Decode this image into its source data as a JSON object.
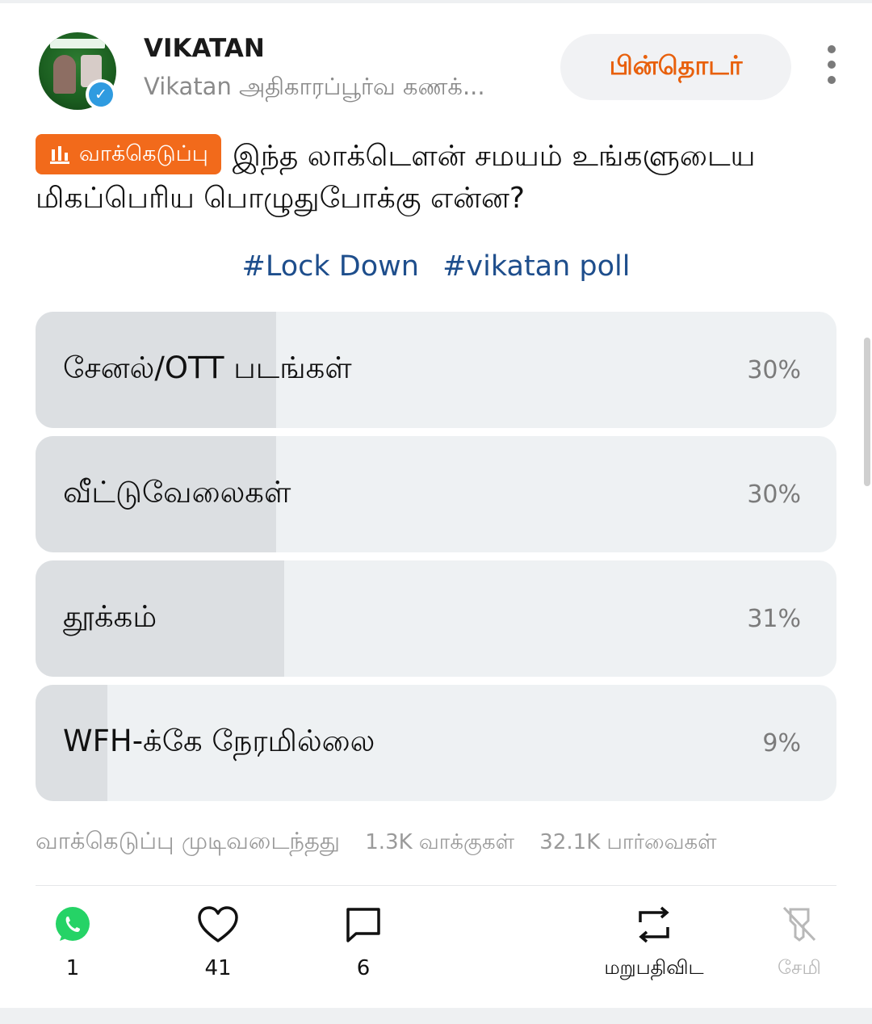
{
  "post": {
    "author_name": "VIKATAN",
    "author_subtitle": "Vikatan அதிகாரப்பூர்வ கணக்...",
    "follow_label": "பின்தொடர்",
    "poll_tag_label": "வாக்கெடுப்பு",
    "question": "இந்த லாக்டௌன் சமயம் உங்களுடைய மிகப்பெரிய பொழுதுபோக்கு என்ன?",
    "hashtags": [
      "#Lock Down",
      "#vikatan poll"
    ]
  },
  "poll": {
    "options": [
      {
        "label": "சேனல்/OTT படங்கள்",
        "percent_text": "30%",
        "percent": 30
      },
      {
        "label": "வீட்டுவேலைகள்",
        "percent_text": "30%",
        "percent": 30
      },
      {
        "label": "தூக்கம்",
        "percent_text": "31%",
        "percent": 31
      },
      {
        "label": "WFH-க்கே நேரமில்லை",
        "percent_text": "9%",
        "percent": 9
      }
    ],
    "status": "வாக்கெடுப்பு முடிவடைந்தது",
    "votes": "1.3K வாக்குகள்",
    "views": "32.1K பார்வைகள்"
  },
  "actions": {
    "whatsapp_count": "1",
    "likes_count": "41",
    "comments_count": "6",
    "reply_label": "மறுபதிவிட",
    "save_label": "சேமி"
  },
  "colors": {
    "accent": "#f26a1b",
    "follow_text": "#e8600c",
    "hashtag": "#1e4e8c",
    "whatsapp": "#25d366",
    "verified": "#2f9be0"
  },
  "icons": [
    "verified-badge-icon",
    "more-options-icon",
    "bar-chart-icon",
    "whatsapp-icon",
    "heart-icon",
    "comment-icon",
    "repost-icon",
    "save-disabled-icon"
  ]
}
